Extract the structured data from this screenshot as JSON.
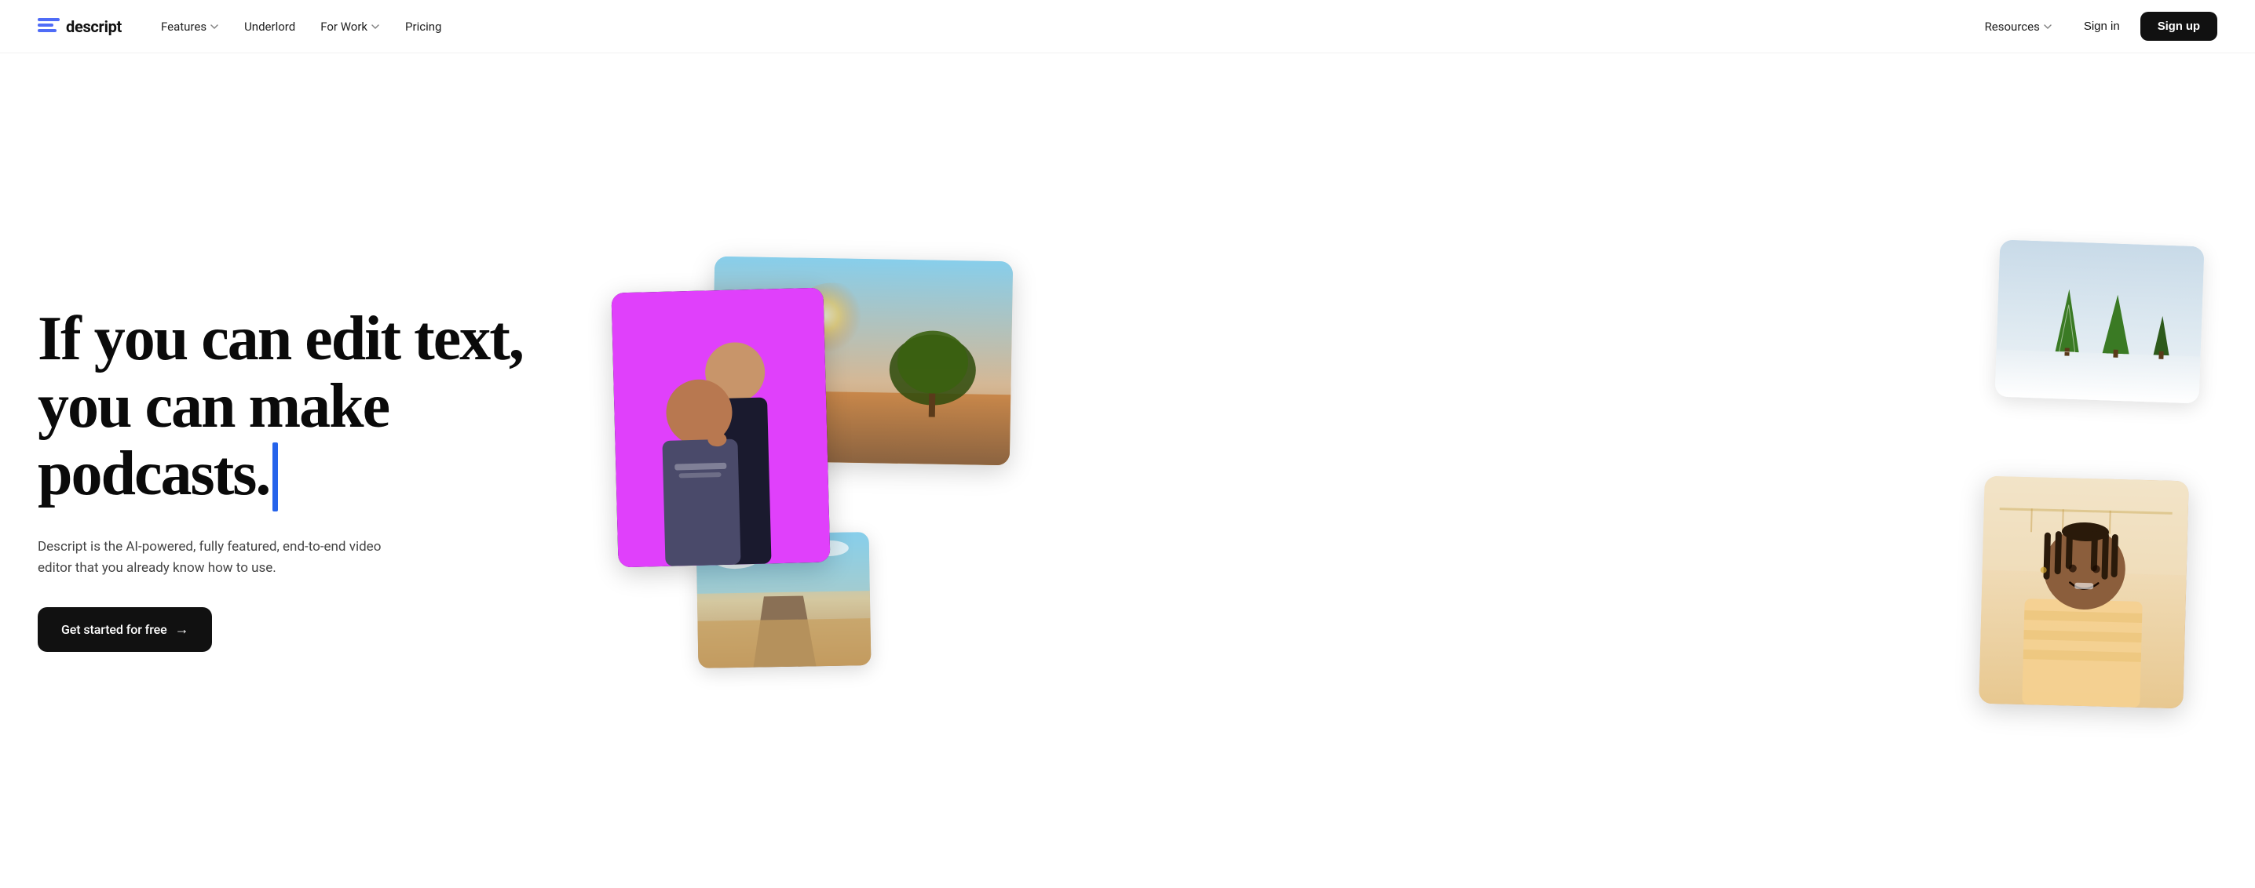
{
  "nav": {
    "logo_text": "descript",
    "links": [
      {
        "label": "Features",
        "has_dropdown": true
      },
      {
        "label": "Underlord",
        "has_dropdown": false
      },
      {
        "label": "For Work",
        "has_dropdown": true
      },
      {
        "label": "Pricing",
        "has_dropdown": false
      }
    ],
    "right_links": [
      {
        "label": "Resources",
        "has_dropdown": true
      }
    ],
    "sign_in": "Sign in",
    "sign_up": "Sign up"
  },
  "hero": {
    "heading_line1": "If you can edit text,",
    "heading_line2": "you can make podcasts.",
    "subtext": "Descript is the AI-powered, fully featured, end-to-end video editor that you already know how to use.",
    "cta_label": "Get started for free",
    "cta_arrow": "→"
  }
}
